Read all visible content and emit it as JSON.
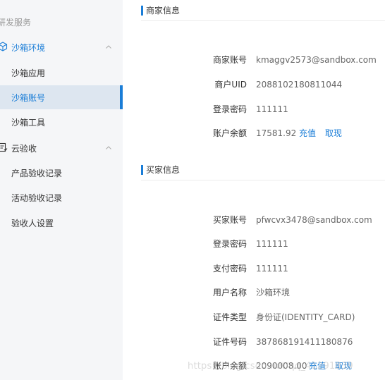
{
  "sidebar": {
    "group_title": "研发服务",
    "sandbox_env": {
      "label": "沙箱环境",
      "items": [
        {
          "label": "沙箱应用"
        },
        {
          "label": "沙箱账号"
        },
        {
          "label": "沙箱工具"
        }
      ]
    },
    "cloud_check": {
      "label": "云验收",
      "items": [
        {
          "label": "产品验收记录"
        },
        {
          "label": "活动验收记录"
        },
        {
          "label": "验收人设置"
        }
      ]
    },
    "active_item": "沙箱账号",
    "accent_color": "#1a7dd7"
  },
  "merchant": {
    "title": "商家信息",
    "account_label": "商家账号",
    "account_value": "kmaggv2573@sandbox.com",
    "uid_label": "商户UID",
    "uid_value": "2088102180811044",
    "password_label": "登录密码",
    "password_value": "111111",
    "balance_label": "账户余额",
    "balance_value": "17581.92",
    "recharge_label": "充值",
    "withdraw_label": "取现"
  },
  "buyer": {
    "title": "买家信息",
    "account_label": "买家账号",
    "account_value": "pfwcvx3478@sandbox.com",
    "password_label": "登录密码",
    "password_value": "111111",
    "pay_password_label": "支付密码",
    "pay_password_value": "111111",
    "username_label": "用户名称",
    "username_value": "沙箱环境",
    "id_type_label": "证件类型",
    "id_type_value": "身份证(IDENTITY_CARD)",
    "id_number_label": "证件号码",
    "id_number_value": "387868191411180876",
    "balance_label": "账户余额",
    "balance_value": "2090008.00",
    "recharge_label": "充值",
    "withdraw_label": "取现"
  },
  "watermark_text": "https://blog.csdn.net/qq_41291839"
}
